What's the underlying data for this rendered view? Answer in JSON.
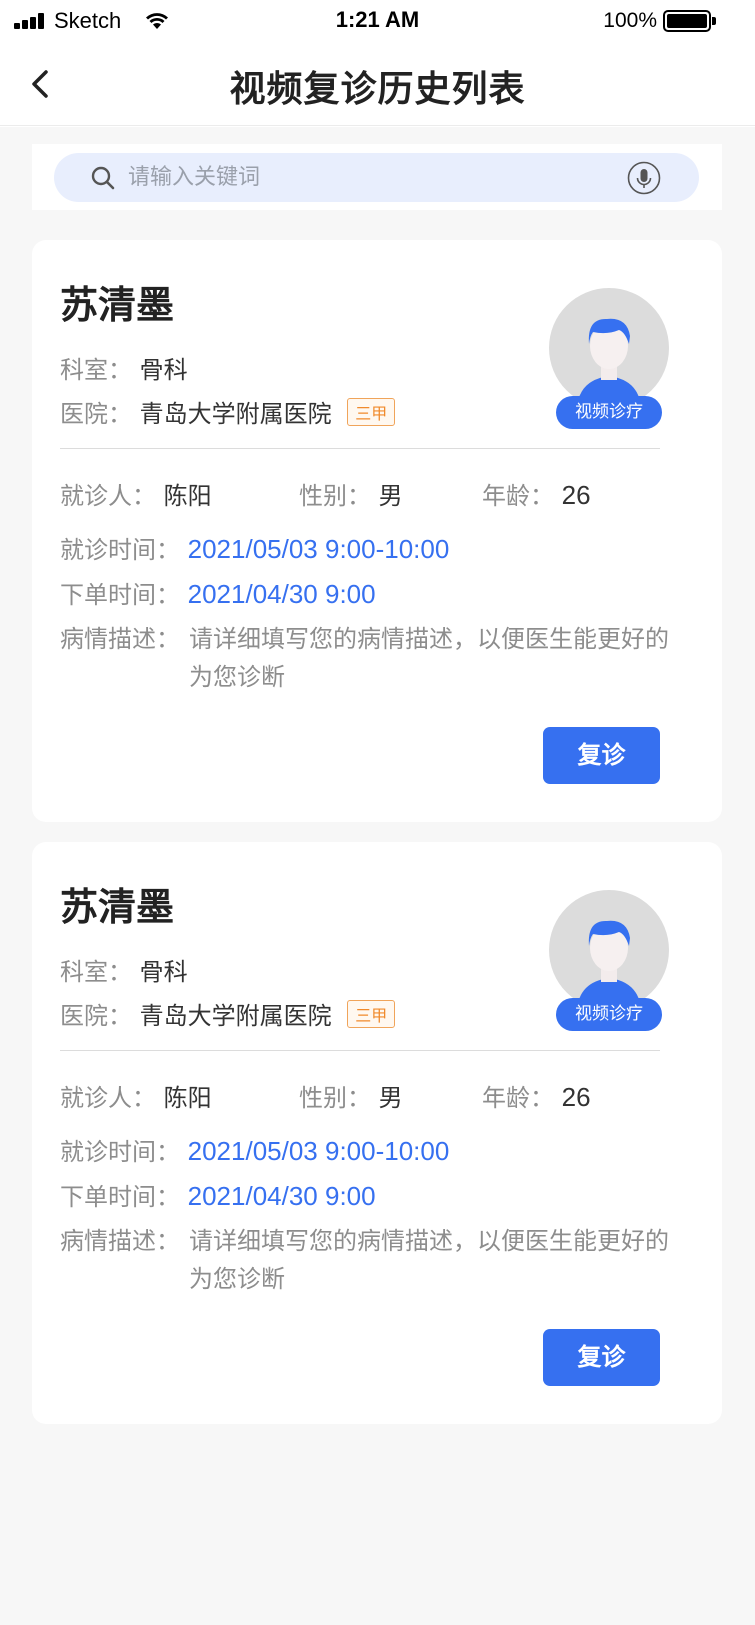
{
  "status_bar": {
    "carrier": "Sketch",
    "time": "1:21 AM",
    "battery_percent": "100%"
  },
  "nav": {
    "title": "视频复诊历史列表",
    "back_icon": "chevron-left-icon"
  },
  "search": {
    "placeholder": "请输入关键词",
    "value": "",
    "left_icon": "search-icon",
    "right_icon": "microphone-icon"
  },
  "labels": {
    "department": "科室：",
    "hospital": "医院：",
    "patient": "就诊人：",
    "gender": "性别：",
    "age": "年龄：",
    "visit_time": "就诊时间：",
    "order_time": "下单时间：",
    "description": "病情描述："
  },
  "records": [
    {
      "doctor_name": "苏清墨",
      "department": "骨科",
      "hospital": "青岛大学附属医院",
      "hospital_grade": "三甲",
      "avatar_badge": "视频诊疗",
      "patient": "陈阳",
      "gender": "男",
      "age": "26",
      "visit_time": "2021/05/03 9:00-10:00",
      "order_time": "2021/04/30 9:00",
      "description": "请详细填写您的病情描述，以便医生能更好的为您诊断",
      "action_label": "复诊"
    },
    {
      "doctor_name": "苏清墨",
      "department": "骨科",
      "hospital": "青岛大学附属医院",
      "hospital_grade": "三甲",
      "avatar_badge": "视频诊疗",
      "patient": "陈阳",
      "gender": "男",
      "age": "26",
      "visit_time": "2021/05/03 9:00-10:00",
      "order_time": "2021/04/30 9:00",
      "description": "请详细填写您的病情描述，以便医生能更好的为您诊断",
      "action_label": "复诊"
    }
  ],
  "colors": {
    "accent": "#3670f0",
    "tag": "#f08a2c",
    "background": "#f7f7f7"
  }
}
